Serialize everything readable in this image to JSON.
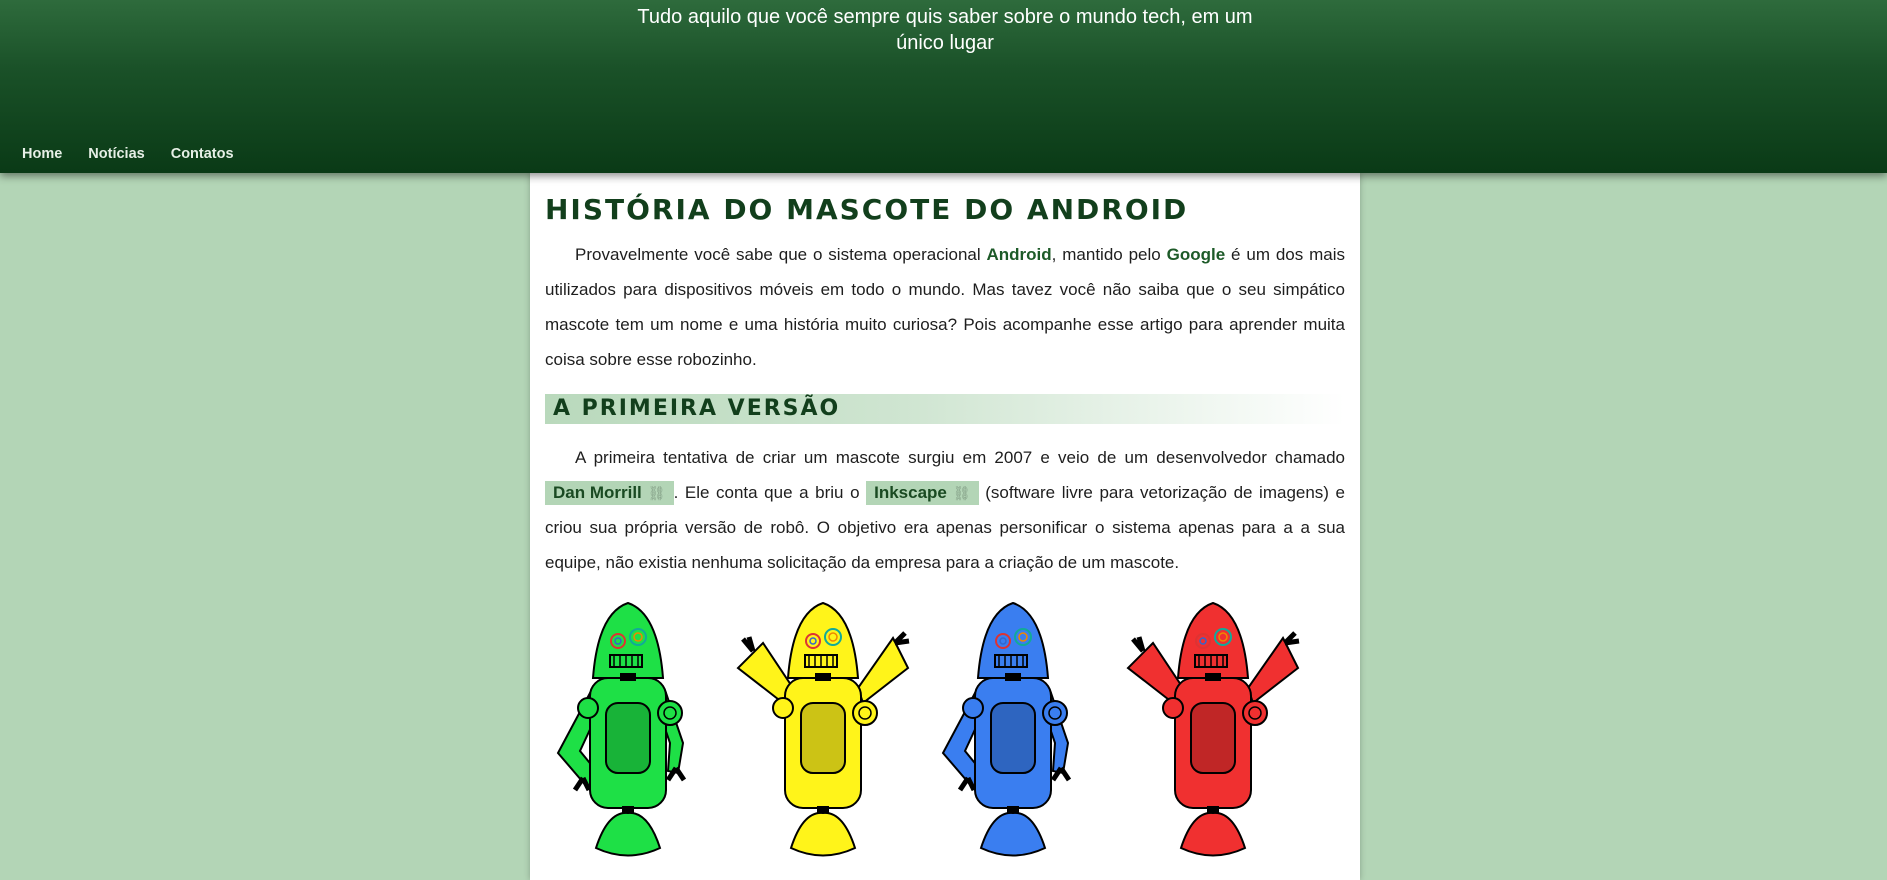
{
  "header": {
    "tagline": "Tudo aquilo que você sempre quis saber sobre o mundo tech, em um único lugar",
    "nav": [
      "Home",
      "Notícias",
      "Contatos"
    ]
  },
  "article": {
    "title": "História do mascote do Android",
    "p1": {
      "t1": "Provavelmente você sabe que o sistema operacional ",
      "b1": "Android",
      "t2": ", mantido pelo ",
      "b2": "Google",
      "t3": " é um dos mais utilizados para dispositivos móveis em todo o mundo. Mas tavez você não saiba que o seu simpático mascote tem um nome e uma história muito curiosa? Pois acompanhe esse artigo para aprender muita coisa sobre esse robozinho."
    },
    "section_title": "A primeira versão",
    "p2": {
      "t1": "A primeira tentativa de criar um mascote surgiu em 2007 e veio de um desenvolvedor chamado ",
      "link1": "Dan Morrill",
      "t2": ". Ele conta que a briu o ",
      "link2": "Inkscape",
      "t3": " (software livre para vetorização de imagens) e criou sua própria versão de robô. O objetivo era apenas personificar o sistema apenas para a a sua equipe, não existia nenhuma solicitação da empresa para a criação de um mascote."
    },
    "link_icon": "link-icon",
    "robot_colors": [
      "#1ee046",
      "#fff41a",
      "#3a7ef0",
      "#f03030"
    ]
  },
  "colors": {
    "page_bg": "#b3d5b6",
    "header_top": "#2e6b3c",
    "header_bottom": "#0a3a16",
    "heading": "#123f1c",
    "bold_text": "#1d5a28"
  }
}
